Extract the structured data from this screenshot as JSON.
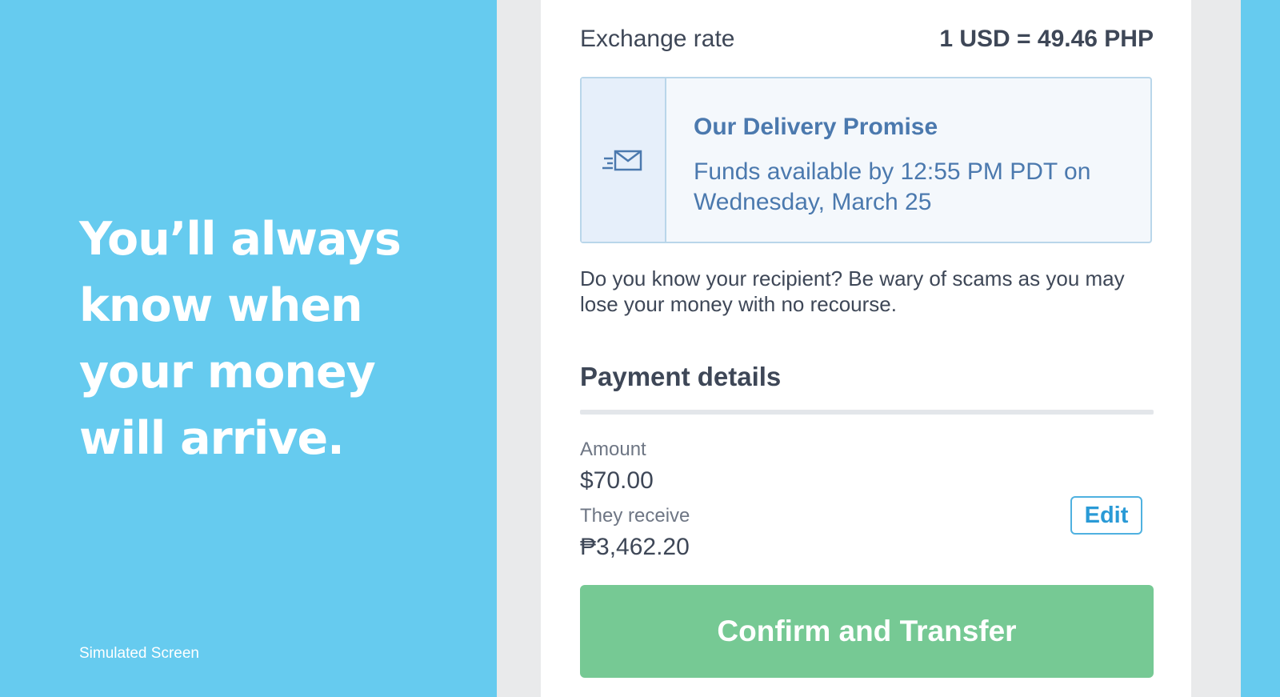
{
  "promo": {
    "headline_lines": [
      "You’ll always",
      "know when",
      "your money",
      "will arrive."
    ],
    "footnote": "Simulated Screen"
  },
  "exchange": {
    "label": "Exchange rate",
    "value": "1 USD = 49.46 PHP"
  },
  "delivery_promise": {
    "icon": "envelope-speed-icon",
    "title": "Our Delivery Promise",
    "text": "Funds available by 12:55 PM PDT on Wednesday, March 25"
  },
  "warning_text": "Do you know your recipient? Be wary of scams as you may lose your money with no recourse.",
  "payment_details": {
    "title": "Payment details",
    "amount_label": "Amount",
    "amount_value": "$70.00",
    "receive_label": "They receive",
    "receive_value": "₱3,462.20",
    "edit_label": "Edit"
  },
  "confirm_label": "Confirm and Transfer",
  "colors": {
    "brand_blue": "#66cbef",
    "confirm_green": "#76c994",
    "promise_text": "#4b79ae",
    "edit_border": "#4fb1e0"
  }
}
